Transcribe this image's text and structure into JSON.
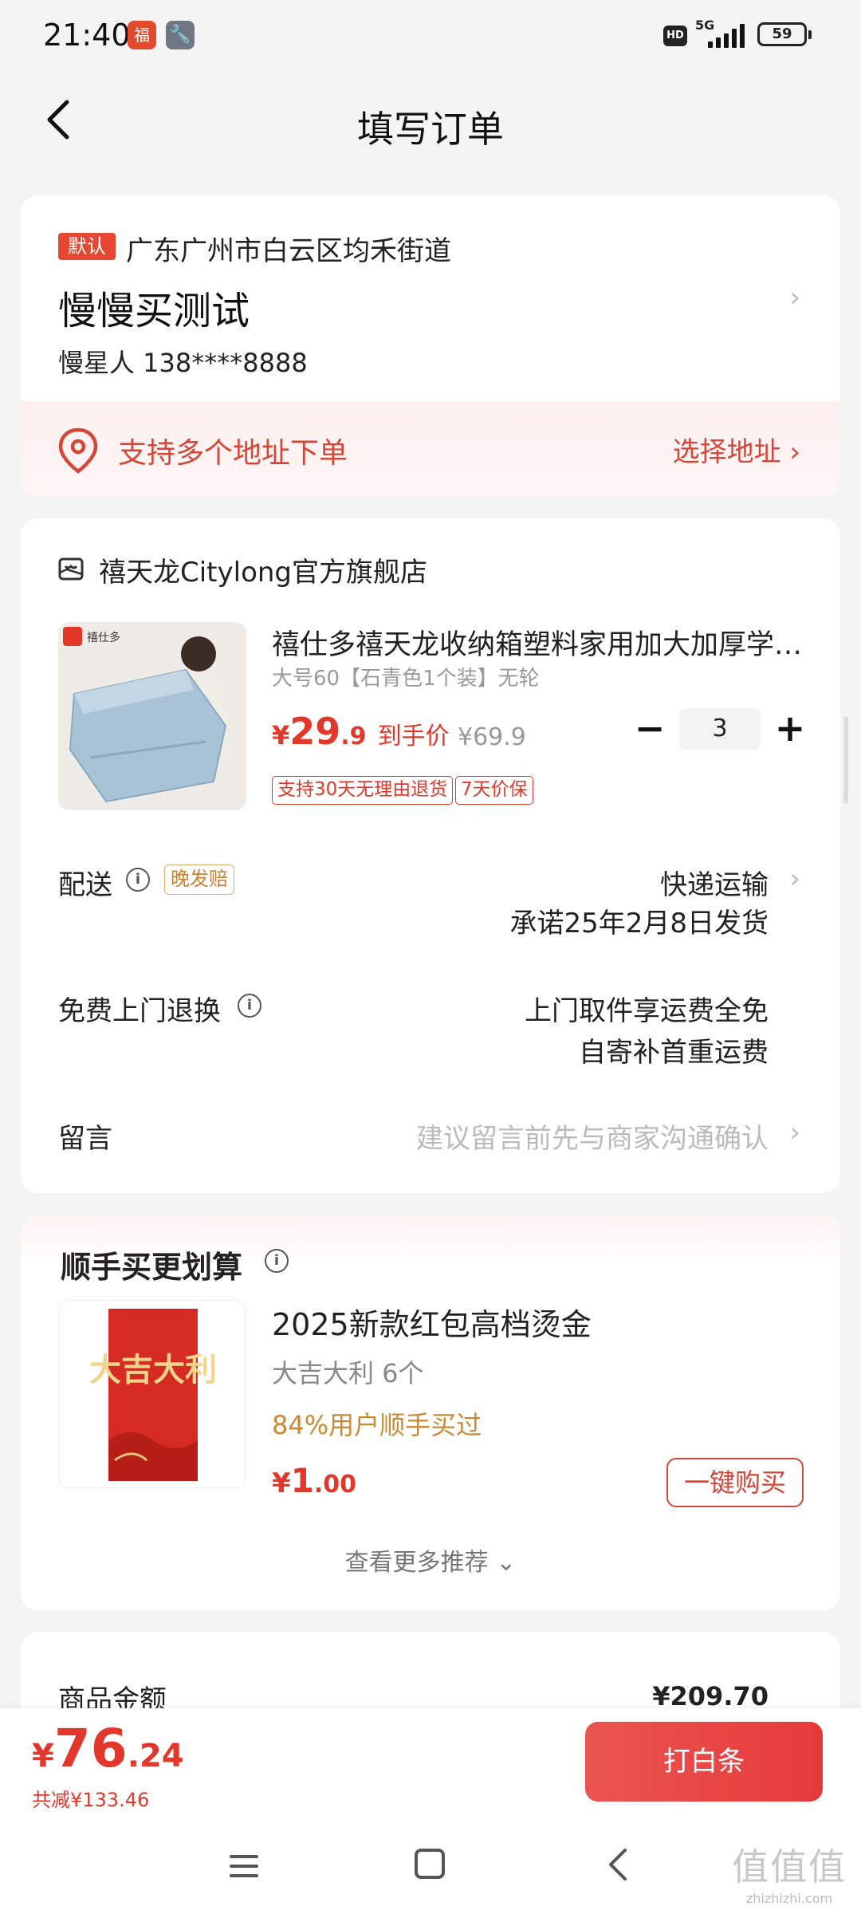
{
  "status_bar": {
    "time": "21:40",
    "app_icon_1": "福",
    "app_icon_2": "🔧",
    "hd_label": "HD",
    "network": "5G",
    "battery": "59"
  },
  "nav": {
    "title": "填写订单"
  },
  "address": {
    "default_tag": "默认",
    "region": "广东广州市白云区均禾街道",
    "name": "慢慢买测试",
    "contact": "慢星人  138****8888",
    "multi_address_text": "支持多个地址下单",
    "choose_address": "选择地址 ›"
  },
  "order": {
    "shop_name": "禧天龙Citylong官方旗舰店",
    "product": {
      "image_brand": "禧仕多",
      "title": "禧仕多禧天龙收纳箱塑料家用加大加厚学…",
      "spec": "大号60【石青色1个装】无轮",
      "price_symbol": "¥",
      "price_int": "29",
      "price_dec": ".9",
      "price_label": "到手价",
      "original_price": "¥69.9",
      "quantity": "3",
      "minus": "−",
      "plus": "+",
      "tags": [
        "支持30天无理由退货",
        "7天价保"
      ]
    },
    "delivery": {
      "label": "配送",
      "late_tag": "晚发赔",
      "method": "快递运输",
      "promise": "承诺25年2月8日发货"
    },
    "return": {
      "label": "免费上门退换",
      "line1": "上门取件享运费全免",
      "line2": "自寄补首重运费"
    },
    "message": {
      "label": "留言",
      "placeholder": "建议留言前先与商家沟通确认"
    }
  },
  "recommend": {
    "title": "顺手买更划算",
    "image_text": "大吉大利",
    "name": "2025新款红包高档烫金",
    "spec": "大吉大利 6个",
    "social": "84%用户顺手买过",
    "price_symbol": "¥",
    "price_int": "1",
    "price_dec": ".00",
    "buy_button": "一键购买",
    "more": "查看更多推荐 ⌄"
  },
  "amount": {
    "label": "商品金额",
    "value": "¥209.70"
  },
  "checkout": {
    "symbol": "¥",
    "total_int": "76",
    "total_dec": ".24",
    "saved": "共减¥133.46",
    "button": "打白条"
  },
  "watermark": {
    "glyphs": "值值值",
    "url": "zhizhizhi.com"
  },
  "colors": {
    "accent_red": "#e2382c",
    "strip_red": "#d2473a",
    "gold": "#c98a34"
  }
}
